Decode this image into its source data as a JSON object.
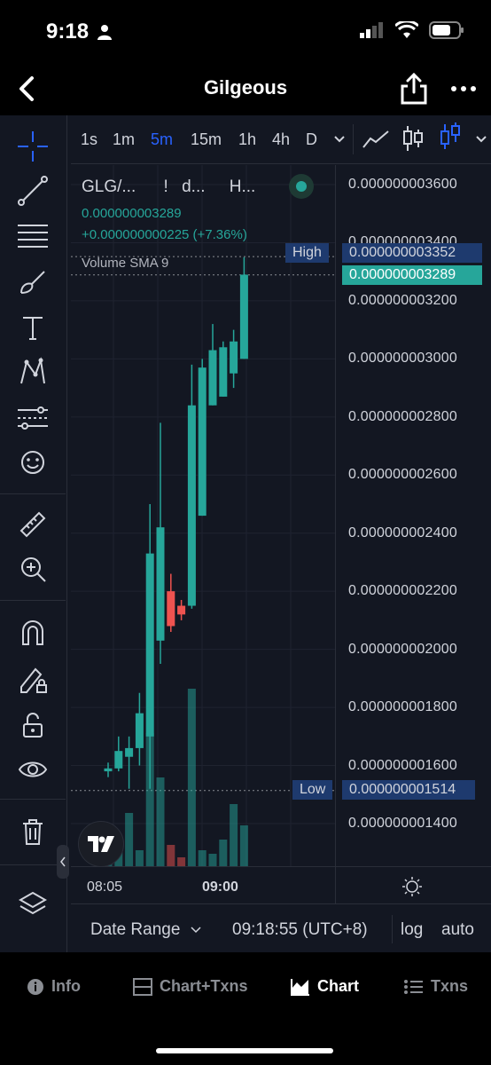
{
  "status_bar": {
    "time": "9:18"
  },
  "nav": {
    "title": "Gilgeous"
  },
  "timeframes": {
    "items": [
      "1s",
      "1m",
      "5m",
      "15m",
      "1h",
      "4h",
      "D"
    ],
    "active": "5m"
  },
  "legend": {
    "symbol": "GLG/...",
    "flag1": "!",
    "field2": "d...",
    "field3": "H...",
    "price": "0.000000003289",
    "change": "+0.000000000225 (+7.36%)",
    "volume_indicator": "Volume SMA 9"
  },
  "price_axis": {
    "labels": [
      "0.000000003600",
      "0.000000003400",
      "0.000000003200",
      "0.000000003000",
      "0.000000002800",
      "0.000000002600",
      "0.000000002400",
      "0.000000002200",
      "0.000000002000",
      "0.000000001800",
      "0.000000001600",
      "0.000000001400"
    ],
    "values": [
      3.6,
      3.4,
      3.2,
      3.0,
      2.8,
      2.6,
      2.4,
      2.2,
      2.0,
      1.8,
      1.6,
      1.4
    ]
  },
  "markers": {
    "high_label": "High",
    "high_value": "0.000000003352",
    "current_value": "0.000000003289",
    "low_label": "Low",
    "low_value": "0.000000001514"
  },
  "time_axis": {
    "labels": [
      "08:05",
      "09:00"
    ]
  },
  "bottom_toolbar": {
    "date_range": "Date Range",
    "clock": "09:18:55 (UTC+8)",
    "log": "log",
    "auto": "auto"
  },
  "tabs": [
    {
      "label": "Info",
      "icon": "info-icon"
    },
    {
      "label": "Chart+Txns",
      "icon": "split-icon"
    },
    {
      "label": "Chart",
      "icon": "area-chart-icon"
    },
    {
      "label": "Txns",
      "icon": "list-icon"
    }
  ],
  "colors": {
    "up": "#26a69a",
    "down": "#ef5350",
    "accent": "#2962ff",
    "background": "#131722"
  },
  "chart_data": {
    "type": "candlestick",
    "unit_note": "prices ×1e-9",
    "ylim": [
      1.3,
      3.7
    ],
    "candles": [
      {
        "o": 1.58,
        "h": 1.61,
        "l": 1.56,
        "c": 1.59
      },
      {
        "o": 1.59,
        "h": 1.7,
        "l": 1.58,
        "c": 1.65
      },
      {
        "o": 1.63,
        "h": 1.7,
        "l": 1.52,
        "c": 1.66
      },
      {
        "o": 1.66,
        "h": 1.85,
        "l": 1.6,
        "c": 1.78
      },
      {
        "o": 1.7,
        "h": 2.5,
        "l": 1.52,
        "c": 2.33
      },
      {
        "o": 2.03,
        "h": 2.78,
        "l": 1.95,
        "c": 2.42
      },
      {
        "o": 2.2,
        "h": 2.26,
        "l": 2.06,
        "c": 2.08
      },
      {
        "o": 2.15,
        "h": 2.17,
        "l": 2.1,
        "c": 2.12
      },
      {
        "o": 2.15,
        "h": 2.98,
        "l": 2.14,
        "c": 2.84
      },
      {
        "o": 2.46,
        "h": 3.0,
        "l": 2.46,
        "c": 2.97
      },
      {
        "o": 2.84,
        "h": 3.12,
        "l": 2.84,
        "c": 3.03
      },
      {
        "o": 2.87,
        "h": 3.06,
        "l": 2.87,
        "c": 3.04
      },
      {
        "o": 2.95,
        "h": 3.1,
        "l": 2.9,
        "c": 3.06
      },
      {
        "o": 3.0,
        "h": 3.35,
        "l": 3.0,
        "c": 3.29
      }
    ],
    "volumes": [
      2,
      8,
      30,
      9,
      75,
      50,
      12,
      5,
      100,
      9,
      7,
      15,
      35,
      23
    ]
  }
}
